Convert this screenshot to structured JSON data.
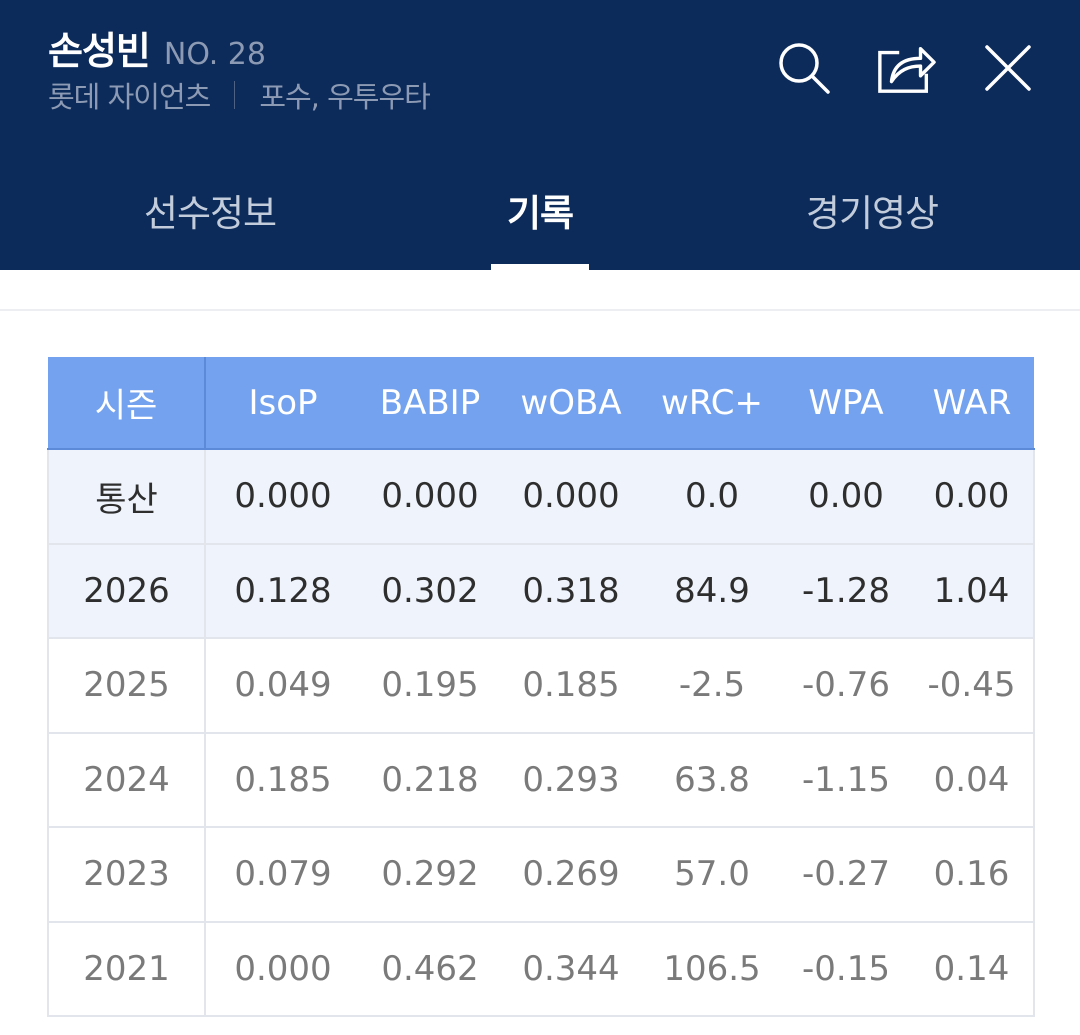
{
  "player": {
    "name": "손성빈",
    "number": "NO. 28",
    "team": "롯데 자이언츠",
    "position": "포수, 우투우타"
  },
  "icons": {
    "search": "search-icon",
    "share": "share-icon",
    "close": "close-icon"
  },
  "tabs": [
    {
      "label": "선수정보",
      "active": false
    },
    {
      "label": "기록",
      "active": true
    },
    {
      "label": "경기영상",
      "active": false
    }
  ],
  "colors": {
    "header_bg": "#0c2b5a",
    "table_header_bg": "#74a2ee",
    "highlight_row_bg": "#eff4fc"
  },
  "table": {
    "headers": [
      "시즌",
      "IsoP",
      "BABIP",
      "wOBA",
      "wRC+",
      "WPA",
      "WAR"
    ],
    "rows": [
      [
        "통산",
        "0.000",
        "0.000",
        "0.000",
        "0.0",
        "0.00",
        "0.00"
      ],
      [
        "2026",
        "0.128",
        "0.302",
        "0.318",
        "84.9",
        "-1.28",
        "1.04"
      ],
      [
        "2025",
        "0.049",
        "0.195",
        "0.185",
        "-2.5",
        "-0.76",
        "-0.45"
      ],
      [
        "2024",
        "0.185",
        "0.218",
        "0.293",
        "63.8",
        "-1.15",
        "0.04"
      ],
      [
        "2023",
        "0.079",
        "0.292",
        "0.269",
        "57.0",
        "-0.27",
        "0.16"
      ],
      [
        "2021",
        "0.000",
        "0.462",
        "0.344",
        "106.5",
        "-0.15",
        "0.14"
      ]
    ]
  }
}
